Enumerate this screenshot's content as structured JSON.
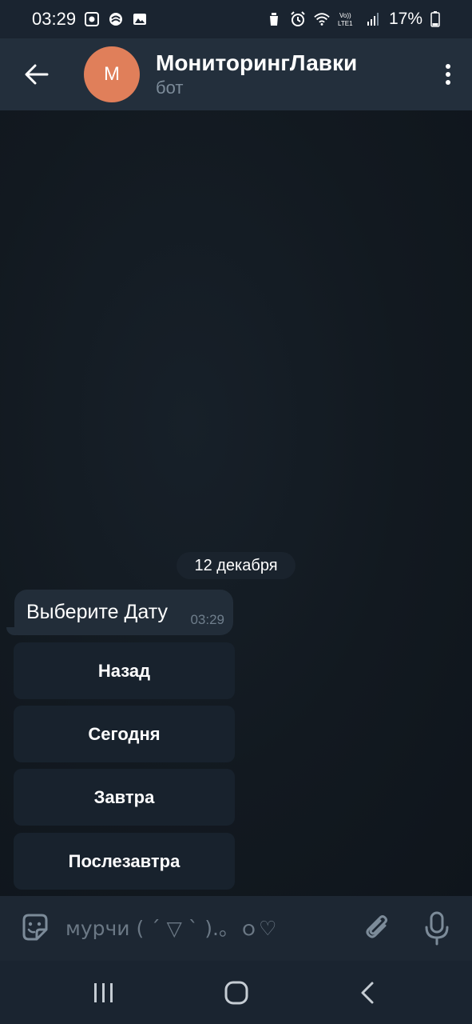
{
  "status_bar": {
    "time": "03:29",
    "battery": "17%",
    "icons": [
      "media-icon",
      "cast-icon",
      "gallery-icon",
      "recycle-icon",
      "alarm-icon",
      "wifi-icon",
      "volte-lte-icon",
      "signal-icon",
      "battery-icon"
    ]
  },
  "header": {
    "avatar_letter": "M",
    "title": "МониторингЛавки",
    "subtitle": "бот",
    "avatar_color": "#e07f5a"
  },
  "chat": {
    "date_label": "12 декабря",
    "message": {
      "text": "Выберите Дату",
      "time": "03:29"
    },
    "keyboard_buttons": [
      "Назад",
      "Сегодня",
      "Завтра",
      "Послезавтра"
    ]
  },
  "composer": {
    "placeholder": "мурчи ( ´ ▽ ` ).。ｏ♡"
  },
  "colors": {
    "accent": "#e07f5a",
    "header_bg": "#232f3c",
    "bubble_bg": "#222d39"
  }
}
